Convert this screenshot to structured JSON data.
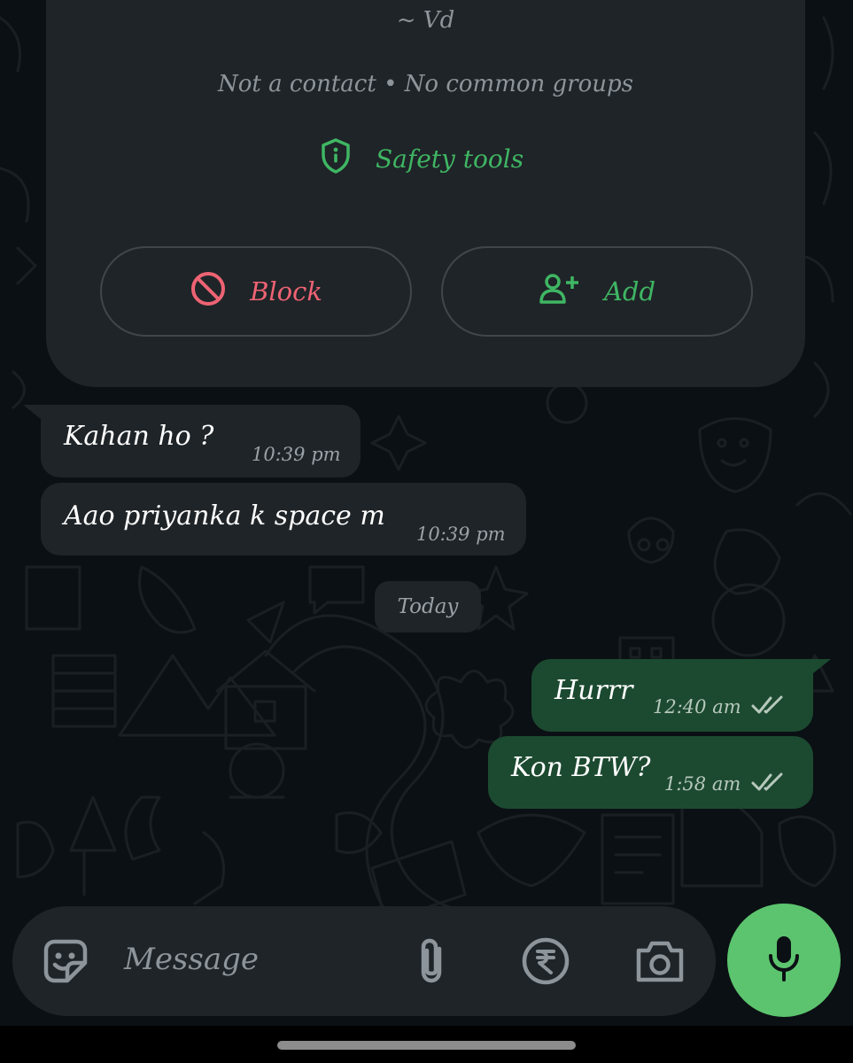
{
  "contact": {
    "name": "~ Vd",
    "subtitle": "Not a contact • No common groups",
    "safety_label": "Safety tools",
    "block_label": "Block",
    "add_label": "Add"
  },
  "messages": [
    {
      "direction": "incoming",
      "text": "Kahan ho ?",
      "time": "10:39 pm"
    },
    {
      "direction": "incoming",
      "text": "Aao priyanka k space m",
      "time": "10:39 pm"
    },
    {
      "direction": "outgoing",
      "text": "Hurrr",
      "time": "12:40 am",
      "status": "read"
    },
    {
      "direction": "outgoing",
      "text": "Kon BTW?",
      "time": "1:58 am",
      "status": "read"
    }
  ],
  "date_divider": "Today",
  "composer": {
    "placeholder": "Message",
    "icons": [
      "sticker-icon",
      "paperclip-icon",
      "rupee-icon",
      "camera-icon",
      "mic-icon"
    ]
  },
  "colors": {
    "background": "#0b1014",
    "card": "#1f2428",
    "outgoing_bubble": "#1c4a30",
    "accent_green": "#3fb663",
    "block_red": "#ee6373",
    "mic_button": "#5cc46e"
  }
}
